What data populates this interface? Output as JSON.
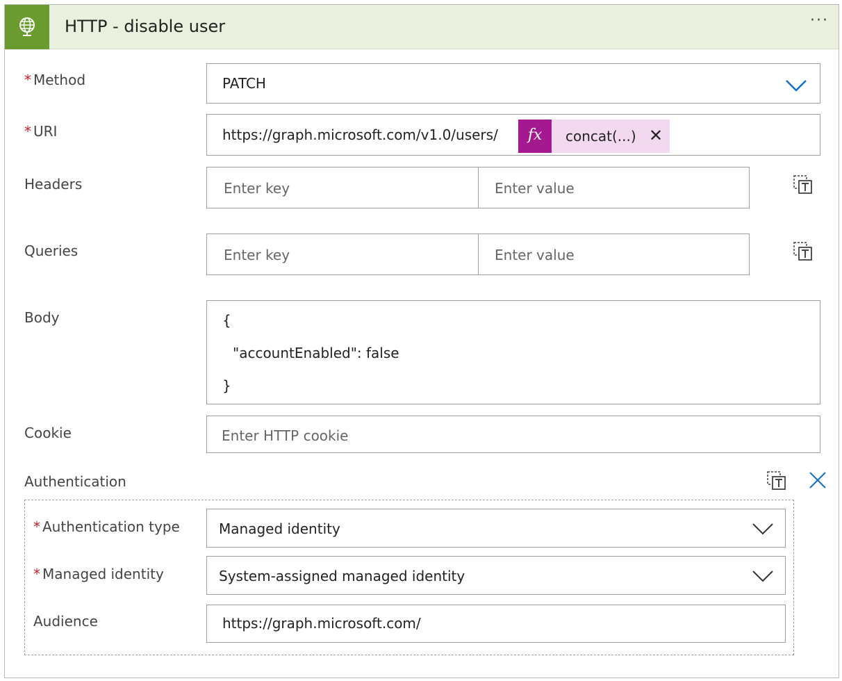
{
  "header": {
    "title": "HTTP - disable user",
    "more_label": "···",
    "icon": "globe-icon",
    "icon_bg": "#6a9b2f",
    "bg": "#e9f0dd"
  },
  "required_marker": "*",
  "method": {
    "label": "Method",
    "value": "PATCH"
  },
  "uri": {
    "label": "URI",
    "value": "https://graph.microsoft.com/v1.0/users/",
    "fx_label": "fx",
    "token_label": "concat(...)",
    "token_remove": "✕",
    "token_color": "#a4198f"
  },
  "headers": {
    "label": "Headers",
    "key_placeholder": "Enter key",
    "value_placeholder": "Enter value"
  },
  "queries": {
    "label": "Queries",
    "key_placeholder": "Enter key",
    "value_placeholder": "Enter value"
  },
  "body": {
    "label": "Body",
    "lines": [
      "{",
      "\"accountEnabled\": false",
      "}"
    ]
  },
  "cookie": {
    "label": "Cookie",
    "placeholder": "Enter HTTP cookie"
  },
  "authentication": {
    "label": "Authentication",
    "type": {
      "label": "Authentication type",
      "value": "Managed identity"
    },
    "managed_identity": {
      "label": "Managed identity",
      "value": "System-assigned managed identity"
    },
    "audience": {
      "label": "Audience",
      "value": "https://graph.microsoft.com/"
    }
  },
  "accent_color": "#1070c8"
}
